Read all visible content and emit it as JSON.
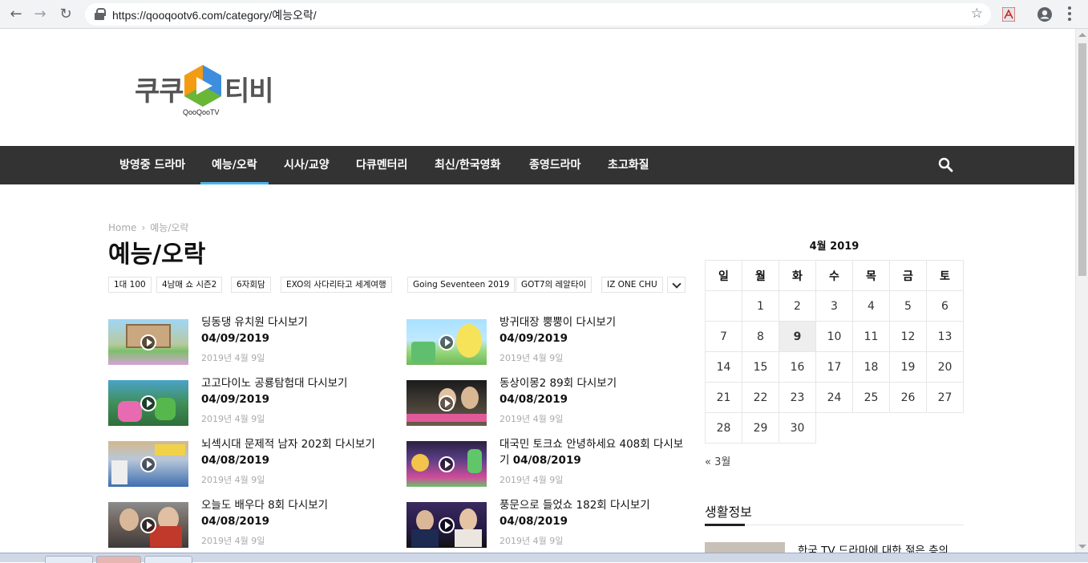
{
  "browser": {
    "url": "https://qooqootv6.com/category/예능오락/",
    "back_icon": "arrow-left-icon",
    "forward_icon": "arrow-right-icon",
    "reload_icon": "reload-icon"
  },
  "site": {
    "logo_left": "쿠쿠",
    "logo_right": "티비",
    "logo_sub": "QooQooTV",
    "nav": [
      "방영중 드라마",
      "예능/오락",
      "시사/교양",
      "다큐멘터리",
      "최신/한국영화",
      "종영드라마",
      "초고화질"
    ],
    "nav_active_index": 1,
    "accent_color": "#4db2ec"
  },
  "breadcrumb": {
    "home": "Home",
    "current": "예능/오락"
  },
  "page_title": "예능/오락",
  "tags": [
    "1대 100",
    "4남매 쇼 시즌2",
    "6자회담",
    "EXO의 사다리타고 세계여행",
    "Going Seventeen 2019",
    "GOT7의 레알타이",
    "IZ ONE CHU"
  ],
  "posts": [
    {
      "title": "딩동댕 유치원 다시보기",
      "date": "04/09/2019",
      "meta": "2019년 4월 9일"
    },
    {
      "title": "방귀대장 뿡뿡이 다시보기",
      "date": "04/09/2019",
      "meta": "2019년 4월 9일"
    },
    {
      "title": "고고다이노 공룡탐험대 다시보기",
      "date": "04/09/2019",
      "meta": "2019년 4월 9일"
    },
    {
      "title": "동상이몽2 89회 다시보기",
      "date": "04/08/2019",
      "meta": "2019년 4월 9일"
    },
    {
      "title": "뇌섹시대 문제적 남자 202회 다시보기",
      "date": "04/08/2019",
      "meta": "2019년 4월 9일"
    },
    {
      "title": "대국민 토크쇼 안녕하세요 408회 다시보기",
      "date": "04/08/2019",
      "meta": "2019년 4월 9일"
    },
    {
      "title": "오늘도 배우다 8회 다시보기",
      "date": "04/08/2019",
      "meta": "2019년 4월 9일"
    },
    {
      "title": "풍문으로 들었쇼 182회 다시보기",
      "date": "04/08/2019",
      "meta": "2019년 4월 9일"
    }
  ],
  "calendar": {
    "caption": "4월 2019",
    "weekdays": [
      "일",
      "월",
      "화",
      "수",
      "목",
      "금",
      "토"
    ],
    "weeks": [
      [
        "",
        "1",
        "2",
        "3",
        "4",
        "5",
        "6"
      ],
      [
        "7",
        "8",
        "9",
        "10",
        "11",
        "12",
        "13"
      ],
      [
        "14",
        "15",
        "16",
        "17",
        "18",
        "19",
        "20"
      ],
      [
        "21",
        "22",
        "23",
        "24",
        "25",
        "26",
        "27"
      ],
      [
        "28",
        "29",
        "30",
        "",
        "",
        "",
        ""
      ]
    ],
    "today": "9",
    "prev_link": "« 3월"
  },
  "sidebar": {
    "widget_title": "생활정보",
    "post_title": "한국 TV 드라마에 대한 젊은 층의"
  }
}
